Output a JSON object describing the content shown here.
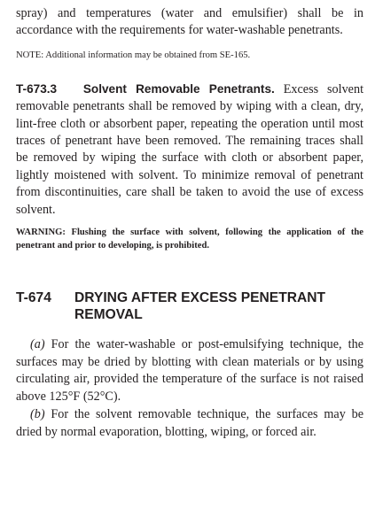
{
  "intro_text": "spray) and temperatures (water and emulsifier) shall be in accordance with the requirements for water-washable penetrants.",
  "note": "NOTE: Additional information may be obtained from SE-165.",
  "t6733": {
    "number": "T-673.3",
    "title": "Solvent Removable Penetrants.",
    "body": "Excess solvent removable penetrants shall be removed by wiping with a clean, dry, lint-free cloth or absorbent paper, repeating the operation until most traces of penetrant have been removed. The remaining traces shall be removed by wiping the surface with cloth or absorbent paper, lightly moistened with solvent. To minimize removal of penetrant from discontinuities, care shall be taken to avoid the use of excess solvent."
  },
  "warning": "WARNING: Flushing the surface with solvent, following the application of the penetrant and prior to developing, is prohibited.",
  "t674": {
    "number": "T-674",
    "title": "DRYING AFTER EXCESS PENETRANT REMOVAL",
    "item_a_label": "(a)",
    "item_a_text": "For the water-washable or post-emulsifying technique, the surfaces may be dried by blotting with clean materials or by using circulating air, provided the temperature of the surface is not raised above 125°F (52°C).",
    "item_b_label": "(b)",
    "item_b_text": "For the solvent removable technique, the surfaces may be dried by normal evaporation, blotting, wiping, or forced air."
  }
}
